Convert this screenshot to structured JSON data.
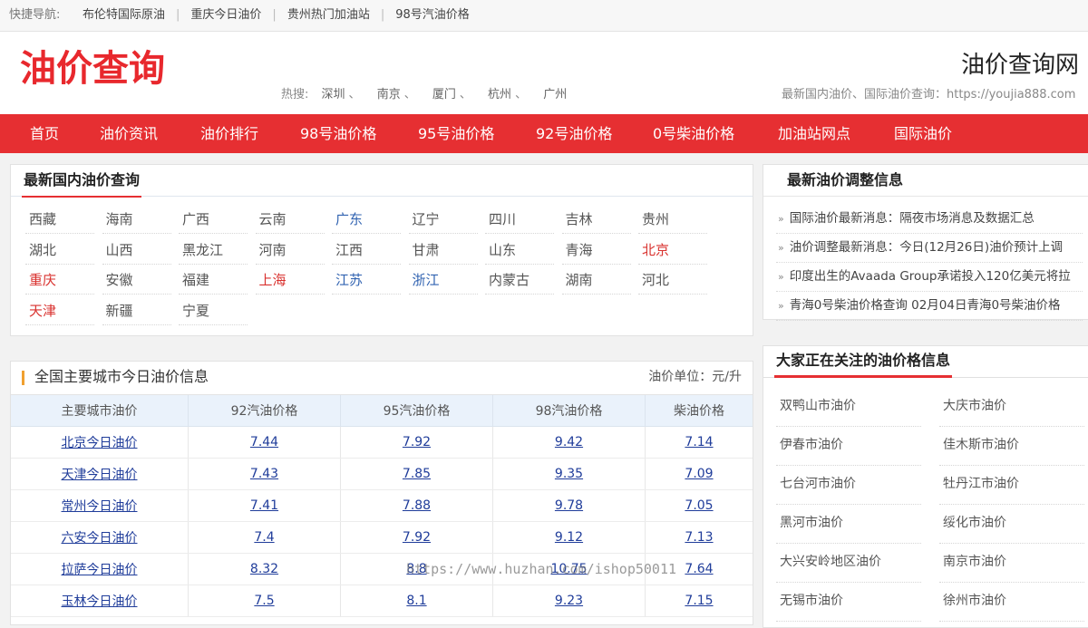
{
  "quicknav": {
    "label": "快捷导航:",
    "links": [
      "布伦特国际原油",
      "重庆今日油价",
      "贵州热门加油站",
      "98号汽油价格"
    ]
  },
  "header": {
    "logo": "油价查询",
    "hot_label": "热搜:",
    "hot_cities": [
      "深圳",
      "南京",
      "厦门",
      "杭州",
      "广州"
    ],
    "hot_sep": "、",
    "site_title": "油价查询网",
    "site_subtitle": "最新国内油价、国际油价查询：https://youjia888.com"
  },
  "mainnav": [
    "首页",
    "油价资讯",
    "油价排行",
    "98号油价格",
    "95号油价格",
    "92号油价格",
    "0号柴油价格",
    "加油站网点",
    "国际油价"
  ],
  "provinces": {
    "title": "最新国内油价查询",
    "items": [
      {
        "name": "西藏",
        "color": "normal"
      },
      {
        "name": "海南",
        "color": "normal"
      },
      {
        "name": "广西",
        "color": "normal"
      },
      {
        "name": "云南",
        "color": "normal"
      },
      {
        "name": "广东",
        "color": "blue"
      },
      {
        "name": "辽宁",
        "color": "normal"
      },
      {
        "name": "四川",
        "color": "normal"
      },
      {
        "name": "吉林",
        "color": "normal"
      },
      {
        "name": "贵州",
        "color": "normal"
      },
      {
        "name": "湖北",
        "color": "normal"
      },
      {
        "name": "山西",
        "color": "normal"
      },
      {
        "name": "黑龙江",
        "color": "normal"
      },
      {
        "name": "河南",
        "color": "normal"
      },
      {
        "name": "江西",
        "color": "normal"
      },
      {
        "name": "甘肃",
        "color": "normal"
      },
      {
        "name": "山东",
        "color": "normal"
      },
      {
        "name": "青海",
        "color": "normal"
      },
      {
        "name": "北京",
        "color": "red"
      },
      {
        "name": "重庆",
        "color": "red"
      },
      {
        "name": "安徽",
        "color": "normal"
      },
      {
        "name": "福建",
        "color": "normal"
      },
      {
        "name": "上海",
        "color": "red"
      },
      {
        "name": "江苏",
        "color": "blue"
      },
      {
        "name": "浙江",
        "color": "blue"
      },
      {
        "name": "内蒙古",
        "color": "normal"
      },
      {
        "name": "湖南",
        "color": "normal"
      },
      {
        "name": "河北",
        "color": "normal"
      },
      {
        "name": "天津",
        "color": "red"
      },
      {
        "name": "新疆",
        "color": "normal"
      },
      {
        "name": "宁夏",
        "color": "normal"
      }
    ]
  },
  "city_table": {
    "title": "全国主要城市今日油价信息",
    "unit": "油价单位：元/升",
    "headers": [
      "主要城市油价",
      "92汽油价格",
      "95汽油价格",
      "98汽油价格",
      "柴油价格"
    ],
    "rows": [
      [
        "北京今日油价",
        "7.44",
        "7.92",
        "9.42",
        "7.14"
      ],
      [
        "天津今日油价",
        "7.43",
        "7.85",
        "9.35",
        "7.09"
      ],
      [
        "常州今日油价",
        "7.41",
        "7.88",
        "9.78",
        "7.05"
      ],
      [
        "六安今日油价",
        "7.4",
        "7.92",
        "9.12",
        "7.13"
      ],
      [
        "拉萨今日油价",
        "8.32",
        "8.8",
        "10.75",
        "7.64"
      ],
      [
        "玉林今日油价",
        "7.5",
        "8.1",
        "9.23",
        "7.15"
      ]
    ]
  },
  "news": {
    "title": "最新油价调整信息",
    "items": [
      "国际油价最新消息：隔夜市场消息及数据汇总",
      "油价调整最新消息：今日(12月26日)油价预计上调",
      "印度出生的Avaada Group承诺投入120亿美元将拉",
      "青海0号柴油价格查询 02月04日青海0号柴油价格"
    ]
  },
  "watched": {
    "title": "大家正在关注的油价格信息",
    "items": [
      "双鸭山市油价",
      "大庆市油价",
      "伊春市油价",
      "佳木斯市油价",
      "七台河市油价",
      "牡丹江市油价",
      "黑河市油价",
      "绥化市油价",
      "大兴安岭地区油价",
      "南京市油价",
      "无锡市油价",
      "徐州市油价"
    ]
  },
  "watermark": "https://www.huzhan.com/ishop50011",
  "colors": {
    "accent": "#e62f32",
    "link_blue": "#1f3c9a",
    "prov_red": "#d9322f",
    "prov_blue": "#3163b1"
  }
}
